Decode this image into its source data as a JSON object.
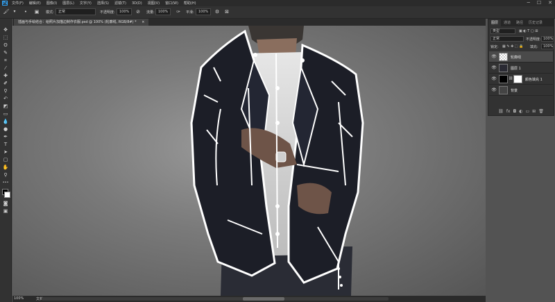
{
  "menubar": {
    "logo": "Ps",
    "items": [
      "文件(F)",
      "编辑(E)",
      "图像(I)",
      "图层(L)",
      "文字(Y)",
      "选择(S)",
      "滤镜(T)",
      "3D(D)",
      "视图(V)",
      "窗口(W)",
      "帮助(H)"
    ],
    "min": "─",
    "max": "☐",
    "close": "✕"
  },
  "options": {
    "mode_label": "模式:",
    "mode_value": "正常",
    "opacity_label": "不透明度:",
    "opacity_value": "100%",
    "flow_label": "流量:",
    "flow_value": "100%",
    "smooth_label": "平滑:",
    "smooth_value": "100%"
  },
  "document": {
    "tab_title": "插画与手绘结合：给照片加描边制作衣服.psd @ 100% (轮廓线, RGB/8#) *",
    "tab_close": "×"
  },
  "status": {
    "zoom": "100%",
    "doc_info": "文档:1.1M/17.9M"
  },
  "layers_panel": {
    "tabs": [
      "图层",
      "通道",
      "路径",
      "历史记录"
    ],
    "kind_label": "类型",
    "blend_mode": "正常",
    "opacity_label": "不透明度:",
    "opacity_value": "100%",
    "lock_label": "锁定:",
    "fill_label": "填充:",
    "fill_value": "100%",
    "layers": [
      {
        "name": "轮廓线",
        "selected": true
      },
      {
        "name": "图层 1",
        "selected": false
      },
      {
        "name": "颜色填充 1",
        "selected": false
      },
      {
        "name": "背景",
        "selected": false
      }
    ]
  },
  "colors": {
    "accent": "#31a8ff",
    "chrome_dark": "#2b2b2b",
    "panel": "#323232",
    "canvas_bg": "#535353"
  }
}
